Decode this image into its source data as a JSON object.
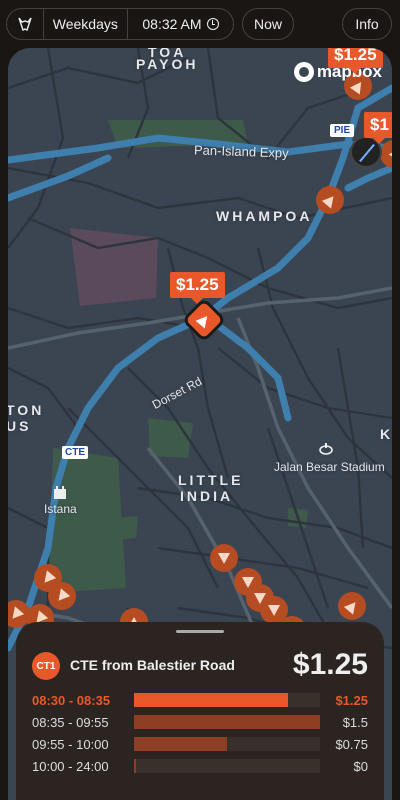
{
  "topbar": {
    "day_filter": "Weekdays",
    "time": "08:32 AM",
    "now_label": "Now",
    "info_label": "Info"
  },
  "map": {
    "labels": {
      "toa_payoh_1": "TOA",
      "toa_payoh_2": "PAYOH",
      "whampoa": "WHAMPOA",
      "pan_island": "Pan-Island Expy",
      "dorset": "Dorset Rd",
      "little_india_1": "LITTLE",
      "little_india_2": "INDIA",
      "jalan_besar": "Jalan Besar Stadium",
      "istana": "Istana",
      "ton": "TON",
      "us": "US",
      "k": "K"
    },
    "shields": {
      "pie": "PIE",
      "cte": "CTE"
    },
    "attribution": "mapbox",
    "price_tags": {
      "main": "$1.25",
      "top_right": "$1.25",
      "right_edge": "$1"
    }
  },
  "gantry": {
    "badge": "CT1",
    "name": "CTE from Balestier Road",
    "current_price": "$1.25",
    "rates": [
      {
        "time": "08:30 - 08:35",
        "price": "$1.25",
        "fraction": 0.83,
        "current": true
      },
      {
        "time": "08:35 - 09:55",
        "price": "$1.5",
        "fraction": 1.0,
        "current": false
      },
      {
        "time": "09:55 - 10:00",
        "price": "$0.75",
        "fraction": 0.5,
        "current": false
      },
      {
        "time": "10:00 - 24:00",
        "price": "$0",
        "fraction": 0.01,
        "current": false
      }
    ]
  },
  "colors": {
    "accent": "#e8582a",
    "map_bg": "#3b4552",
    "expressway": "#3f7fae",
    "sheet_bg": "#2b2420"
  }
}
